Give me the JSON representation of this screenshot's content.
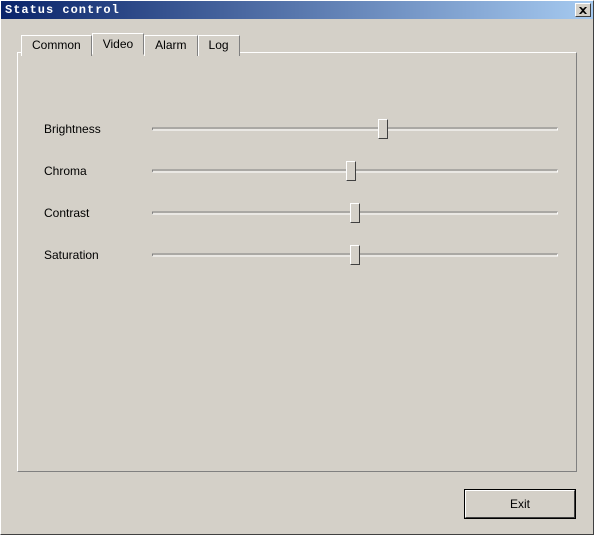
{
  "window": {
    "title": "Status control"
  },
  "tabs": [
    {
      "label": "Common",
      "active": false
    },
    {
      "label": "Video",
      "active": true
    },
    {
      "label": "Alarm",
      "active": false
    },
    {
      "label": "Log",
      "active": false
    }
  ],
  "sliders": [
    {
      "label": "Brightness",
      "value": 57
    },
    {
      "label": "Chroma",
      "value": 49
    },
    {
      "label": "Contrast",
      "value": 50
    },
    {
      "label": "Saturation",
      "value": 50
    }
  ],
  "buttons": {
    "exit": "Exit"
  }
}
